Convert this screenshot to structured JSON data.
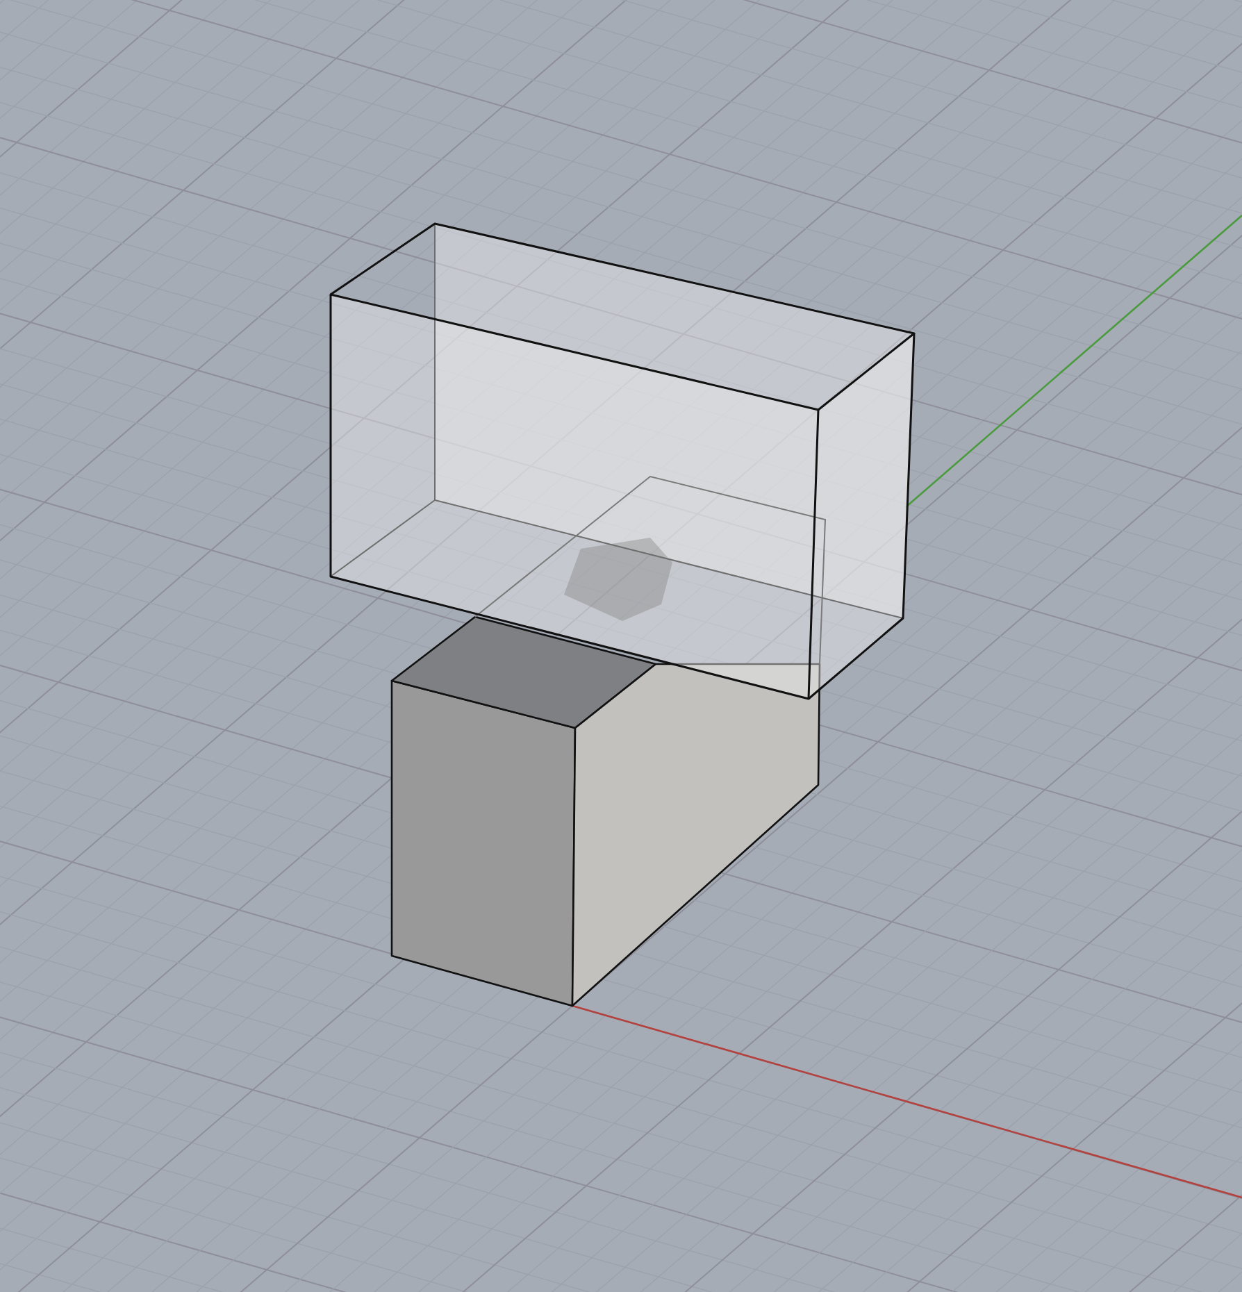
{
  "viewport": {
    "grid": true,
    "axes": true,
    "objects": [
      {
        "kind": "solid-box"
      },
      {
        "kind": "ghosted-box"
      }
    ]
  }
}
